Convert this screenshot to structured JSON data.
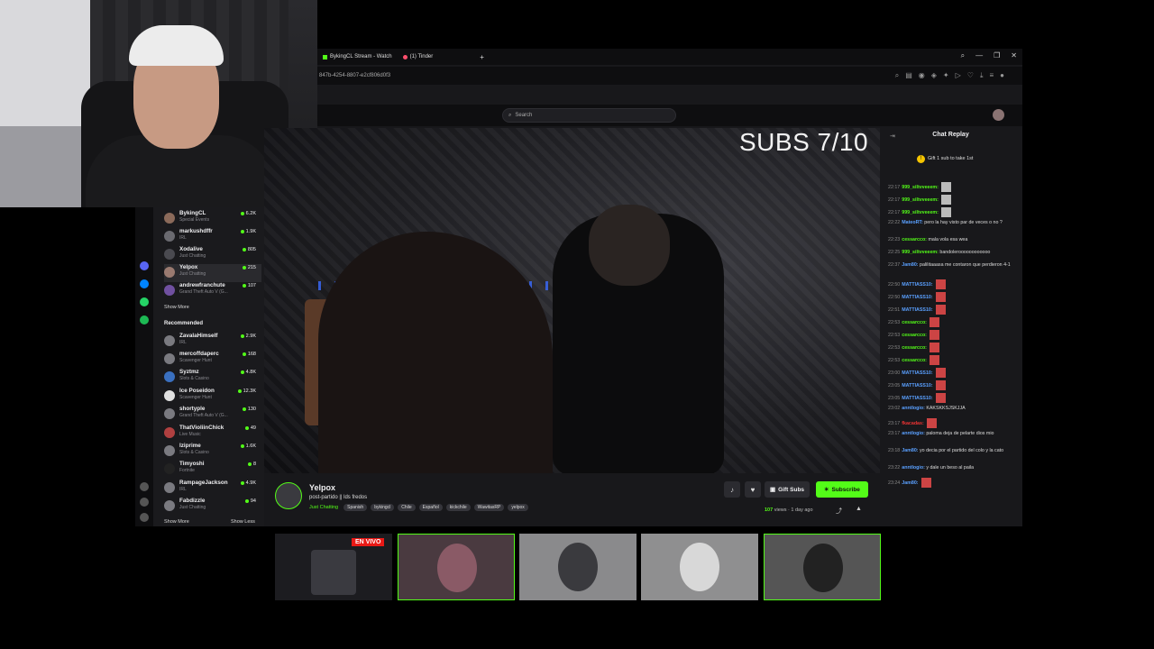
{
  "browser": {
    "tabs": [
      {
        "label": "BykingCL Stream - Watch"
      },
      {
        "label": "(1) Tinder"
      }
    ],
    "new_tab": "+",
    "url": "847b-4254-8807-e2cf806d0f3",
    "window_controls": [
      "⌕",
      "—",
      "❐",
      "✕"
    ]
  },
  "topnav": {
    "search_placeholder": "Search"
  },
  "overlay": {
    "subs_text": "SUBS 7/10"
  },
  "sidebar": {
    "following": [
      {
        "name": "BykingCL",
        "sub": "Special Events",
        "viewers": "6.2K"
      },
      {
        "name": "markushdffr",
        "sub": "IRL",
        "viewers": "1.9K"
      },
      {
        "name": "Xodalive",
        "sub": "Just Chatting",
        "viewers": "805"
      },
      {
        "name": "Yelpox",
        "sub": "Just Chatting",
        "viewers": "215"
      },
      {
        "name": "andrewfranchute",
        "sub": "Grand Theft Auto V (G...",
        "viewers": "107"
      }
    ],
    "show_more": "Show More",
    "recommended_heading": "Recommended",
    "recommended": [
      {
        "name": "ZavalaHimself",
        "sub": "IRL",
        "viewers": "2.9K"
      },
      {
        "name": "mercoffdaperc",
        "sub": "Scavenger Hunt",
        "viewers": "168"
      },
      {
        "name": "Syztmz",
        "sub": "Slots & Casino",
        "viewers": "4.8K"
      },
      {
        "name": "Ice Poseidon",
        "sub": "Scavenger Hunt",
        "viewers": "12.3K"
      },
      {
        "name": "shortyple",
        "sub": "Grand Theft Auto V (G...",
        "viewers": "130"
      },
      {
        "name": "ThatVioliinChick",
        "sub": "Live Music",
        "viewers": "49"
      },
      {
        "name": "Iziprime",
        "sub": "Slots & Casino",
        "viewers": "1.6K"
      },
      {
        "name": "Timyoshi",
        "sub": "Fortnite",
        "viewers": "8"
      },
      {
        "name": "RampageJackson",
        "sub": "IRL",
        "viewers": "4.9K"
      },
      {
        "name": "Fabdizzle",
        "sub": "Just Chatting",
        "viewers": "94"
      }
    ],
    "show_more_2": "Show More",
    "show_less": "Show Less"
  },
  "stream": {
    "name": "Yelpox",
    "title": "post-partido || lds fredos",
    "category": "Just Chatting",
    "tags": [
      "Spanish",
      "bykingcl",
      "Chile",
      "Español",
      "kickchile",
      "WawitasRP",
      "yelpox"
    ],
    "gift_label": "Gift Subs",
    "subscribe_label": "Subscribe",
    "views_count": "107",
    "views_text": "views",
    "age": "· 1 day ago"
  },
  "chat": {
    "title": "Chat Replay",
    "pinned": "Gift 1 sub to take 1st",
    "messages": [
      {
        "ts": "22:17",
        "user": "999_siltvveeem:",
        "text": "",
        "color": "#53fc18",
        "emote": "g"
      },
      {
        "ts": "22:17",
        "user": "999_siltvveeem:",
        "text": "",
        "color": "#53fc18",
        "emote": "g"
      },
      {
        "ts": "22:17",
        "user": "999_siltvveeem:",
        "text": "",
        "color": "#53fc18",
        "emote": "g"
      },
      {
        "ts": "22:22",
        "user": "MateoRT:",
        "text": "pero la hay visto par de veces o no ?",
        "color": "#5aa0ff",
        "emote": ""
      },
      {
        "ts": "22:23",
        "user": "cessarcco:",
        "text": "mala vola esa wea",
        "color": "#53fc18",
        "emote": ""
      },
      {
        "ts": "22:25",
        "user": "999_siltvveeem:",
        "text": "bandoleroooooooooooo",
        "color": "#53fc18",
        "emote": ""
      },
      {
        "ts": "22:37",
        "user": "Jam80:",
        "text": "palilitaaasa me contaron que perdieron 4-1",
        "color": "#5aa0ff",
        "emote": ""
      },
      {
        "ts": "22:50",
        "user": "MATTIASS10:",
        "text": "",
        "color": "#5aa0ff",
        "emote": "r"
      },
      {
        "ts": "22:50",
        "user": "MATTIASS10:",
        "text": "",
        "color": "#5aa0ff",
        "emote": "r"
      },
      {
        "ts": "22:51",
        "user": "MATTIASS10:",
        "text": "",
        "color": "#5aa0ff",
        "emote": "r"
      },
      {
        "ts": "22:53",
        "user": "cessarcco:",
        "text": "",
        "color": "#53fc18",
        "emote": "r"
      },
      {
        "ts": "22:53",
        "user": "cessarcco:",
        "text": "",
        "color": "#53fc18",
        "emote": "r"
      },
      {
        "ts": "22:53",
        "user": "cessarcco:",
        "text": "",
        "color": "#53fc18",
        "emote": "r"
      },
      {
        "ts": "22:53",
        "user": "cessarcco:",
        "text": "",
        "color": "#53fc18",
        "emote": "r"
      },
      {
        "ts": "23:00",
        "user": "MATTIASS10:",
        "text": "",
        "color": "#5aa0ff",
        "emote": "r"
      },
      {
        "ts": "23:05",
        "user": "MATTIASS10:",
        "text": "",
        "color": "#5aa0ff",
        "emote": "r"
      },
      {
        "ts": "23:05",
        "user": "MATTIASS10:",
        "text": "",
        "color": "#5aa0ff",
        "emote": "r"
      },
      {
        "ts": "23:02",
        "user": "anntlogio:",
        "text": "KAKSKKSJSKJJA",
        "color": "#5aa0ff",
        "emote": ""
      },
      {
        "ts": "23:17",
        "user": "fkacadas:",
        "text": "",
        "color": "#e33",
        "emote": "r"
      },
      {
        "ts": "23:17",
        "user": "anntlogio:",
        "text": "paloma deja de pelarte dios mio",
        "color": "#5aa0ff",
        "emote": ""
      },
      {
        "ts": "23:18",
        "user": "Jam80:",
        "text": "yo decia por el partido del colo y la cato",
        "color": "#5aa0ff",
        "emote": ""
      },
      {
        "ts": "23:22",
        "user": "anntlogio:",
        "text": "y dale un beso al paila",
        "color": "#5aa0ff",
        "emote": ""
      },
      {
        "ts": "23:24",
        "user": "Jam80:",
        "text": "",
        "color": "#5aa0ff",
        "emote": "r"
      }
    ]
  },
  "thumbs": {
    "live_badge": "EN VIVO"
  },
  "colors": {
    "accent": "#53fc18",
    "live": "#e91916",
    "bg": "#18181b"
  }
}
